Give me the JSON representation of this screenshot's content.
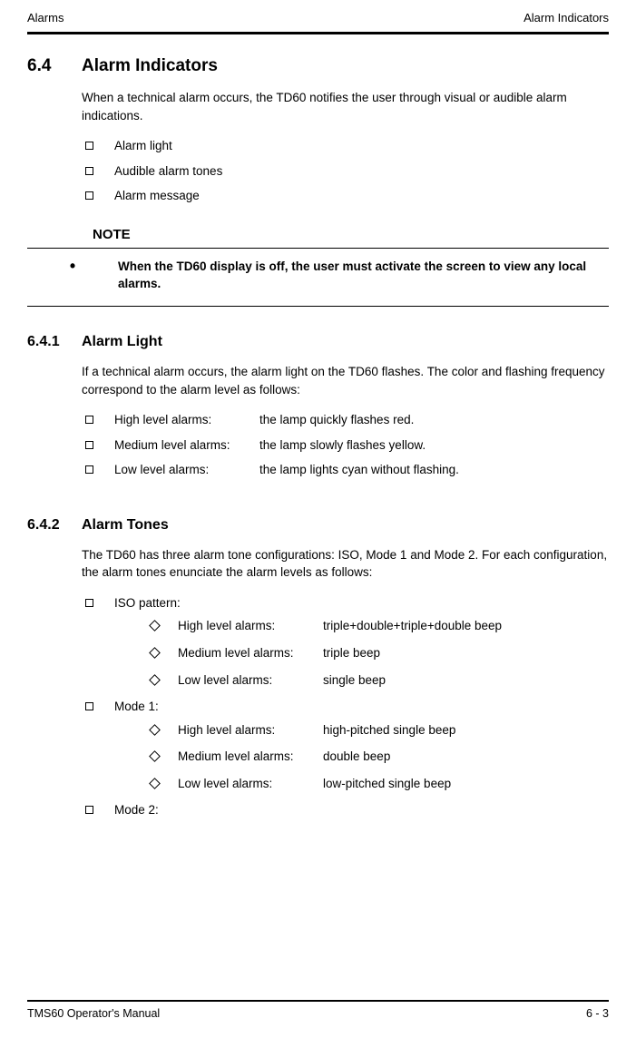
{
  "header": {
    "left": "Alarms",
    "right": "Alarm Indicators"
  },
  "s64": {
    "num": "6.4",
    "title": "Alarm Indicators",
    "intro": "When a technical alarm occurs, the TD60 notifies the user through visual or audible alarm indications.",
    "items": [
      "Alarm light",
      "Audible alarm tones",
      "Alarm message"
    ]
  },
  "note": {
    "label": "NOTE",
    "bullet": "•",
    "text": "When the TD60 display is off, the user must activate the screen to view any local alarms."
  },
  "s641": {
    "num": "6.4.1",
    "title": "Alarm Light",
    "intro": "If a technical alarm occurs, the alarm light on the TD60 flashes. The color and flashing frequency correspond to the alarm level as follows:",
    "rows": [
      {
        "label": "High level alarms:",
        "val": "the lamp quickly flashes red."
      },
      {
        "label": "Medium level alarms:",
        "val": "the lamp slowly flashes yellow."
      },
      {
        "label": "Low level alarms:",
        "val": "the lamp lights cyan without flashing."
      }
    ]
  },
  "s642": {
    "num": "6.4.2",
    "title": "Alarm Tones",
    "intro": "The TD60 has three alarm tone configurations: ISO, Mode 1 and Mode 2. For each configuration, the alarm tones enunciate the alarm levels as follows:",
    "groups": [
      {
        "name": "ISO pattern:",
        "rows": [
          {
            "label": "High level alarms:",
            "val": "triple+double+triple+double beep"
          },
          {
            "label": "Medium level alarms:",
            "val": "triple beep"
          },
          {
            "label": "Low level alarms:",
            "val": "single beep"
          }
        ]
      },
      {
        "name": "Mode 1:",
        "rows": [
          {
            "label": "High level alarms:",
            "val": "high-pitched single beep"
          },
          {
            "label": "Medium level alarms:",
            "val": "double beep"
          },
          {
            "label": "Low level alarms:",
            "val": "low-pitched single beep"
          }
        ]
      },
      {
        "name": "Mode 2:",
        "rows": []
      }
    ]
  },
  "footer": {
    "left": "TMS60 Operator's Manual",
    "right": "6 - 3"
  }
}
